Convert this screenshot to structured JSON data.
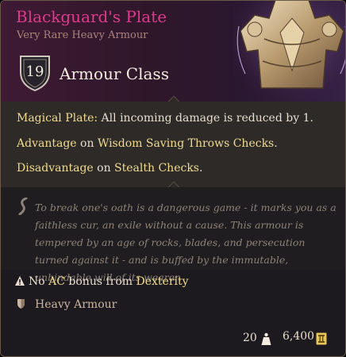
{
  "item": {
    "name": "Blackguard's Plate",
    "rarity_type": "Very Rare Heavy Armour",
    "name_color": "#e0388c",
    "armour_class": {
      "value": "19",
      "label": "Armour Class"
    }
  },
  "passives": {
    "magical_plate": {
      "name": "Magical Plate:",
      "text": " All incoming damage is reduced by 1."
    },
    "advantage": {
      "k1": "Advantage",
      "t1": " on ",
      "k2": "Wisdom Saving Throws",
      "t2": " ",
      "k3": "Checks",
      "t3": "."
    },
    "disadvantage": {
      "k1": "Disadvantage",
      "t1": " on ",
      "k2": "Stealth",
      "t2": " ",
      "k3": "Checks",
      "t3": "."
    }
  },
  "lore": "To break one's oath is a dangerous game - it marks you as a faithless cur, an exile without a cause. This armour is tempered by an age of rocks, blades, and persecution turned against it - and is buffed by the immutable, unbindable will of its wearer.",
  "restriction": {
    "t1": "No ",
    "k1": "AC",
    "t2": " bonus from ",
    "k2": "Dexterity"
  },
  "proficiency": "Heavy Armour",
  "footer": {
    "weight": "20",
    "value": "6,400"
  },
  "icons": [
    "armour-art-icon",
    "ac-shield-icon",
    "quote-icon",
    "warning-icon",
    "heavy-armour-icon",
    "weight-icon",
    "gold-coin-icon"
  ]
}
